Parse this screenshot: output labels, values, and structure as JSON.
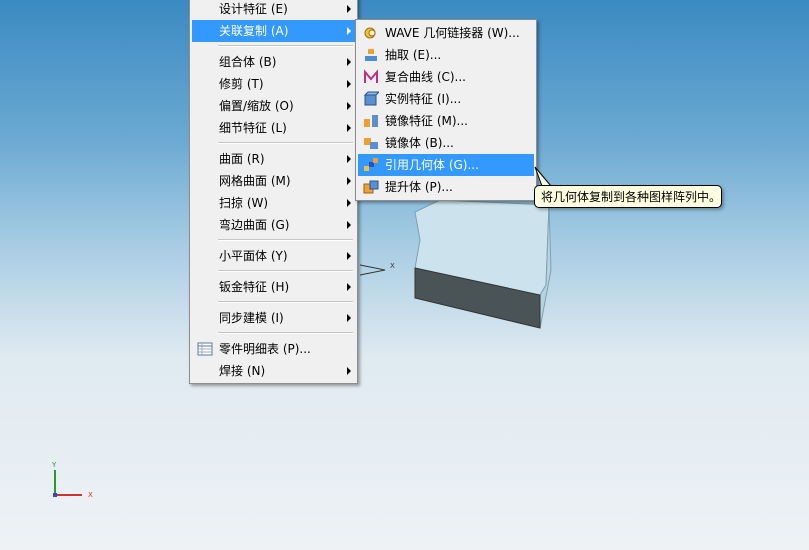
{
  "main_menu": {
    "items": [
      {
        "label": "设计特征 (E)",
        "submenu": true
      },
      {
        "label": "关联复制 (A)",
        "submenu": true,
        "highlight": true
      },
      {
        "label": "组合体 (B)",
        "submenu": true
      },
      {
        "label": "修剪 (T)",
        "submenu": true
      },
      {
        "label": "偏置/缩放 (O)",
        "submenu": true
      },
      {
        "label": "细节特征 (L)",
        "submenu": true
      },
      {
        "label": "曲面 (R)",
        "submenu": true
      },
      {
        "label": "网格曲面 (M)",
        "submenu": true
      },
      {
        "label": "扫掠 (W)",
        "submenu": true
      },
      {
        "label": "弯边曲面 (G)",
        "submenu": true
      },
      {
        "label": "小平面体 (Y)",
        "submenu": true
      },
      {
        "label": "钣金特征 (H)",
        "submenu": true
      },
      {
        "label": "同步建模 (I)",
        "submenu": true
      },
      {
        "label": "零件明细表 (P)...",
        "submenu": false
      },
      {
        "label": "焊接 (N)",
        "submenu": true
      }
    ]
  },
  "sub_menu": {
    "items": [
      {
        "label": "WAVE 几何链接器 (W)...",
        "icon": "wave-link-icon"
      },
      {
        "label": "抽取 (E)...",
        "icon": "extract-icon"
      },
      {
        "label": "复合曲线 (C)...",
        "icon": "composite-curve-icon"
      },
      {
        "label": "实例特征 (I)...",
        "icon": "instance-feature-icon"
      },
      {
        "label": "镜像特征 (M)...",
        "icon": "mirror-feature-icon"
      },
      {
        "label": "镜像体 (B)...",
        "icon": "mirror-body-icon"
      },
      {
        "label": "引用几何体 (G)...",
        "icon": "instance-geometry-icon",
        "highlight": true
      },
      {
        "label": "提升体 (P)...",
        "icon": "promote-body-icon"
      }
    ]
  },
  "tooltip": {
    "text": "将几何体复制到各种图样阵列中。"
  },
  "axes": {
    "x_label": "X",
    "y_label": "Y",
    "small_x_label": "X"
  },
  "colors": {
    "highlight": "#3399ff",
    "menu_bg": "#f0f0f0",
    "tooltip_bg": "#ffffe1"
  }
}
